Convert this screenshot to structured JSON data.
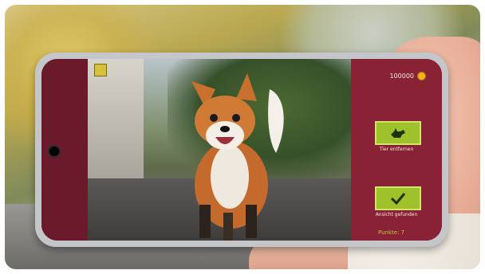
{
  "app": {
    "score_label": "100000",
    "remove_animal_label": "Tier entfernen",
    "confirm_label": "Ansicht gefunden",
    "footer_text": "Punkte: 7"
  },
  "colors": {
    "side_panel": "#8a2236",
    "button_green": "#9ec12c",
    "coin": "#f2b21b"
  },
  "icons": {
    "remove_button_icon": "fox-silhouette-icon",
    "confirm_button_icon": "checkmark-icon",
    "score_icon": "coin-icon",
    "top_left_icon": "map-icon"
  }
}
